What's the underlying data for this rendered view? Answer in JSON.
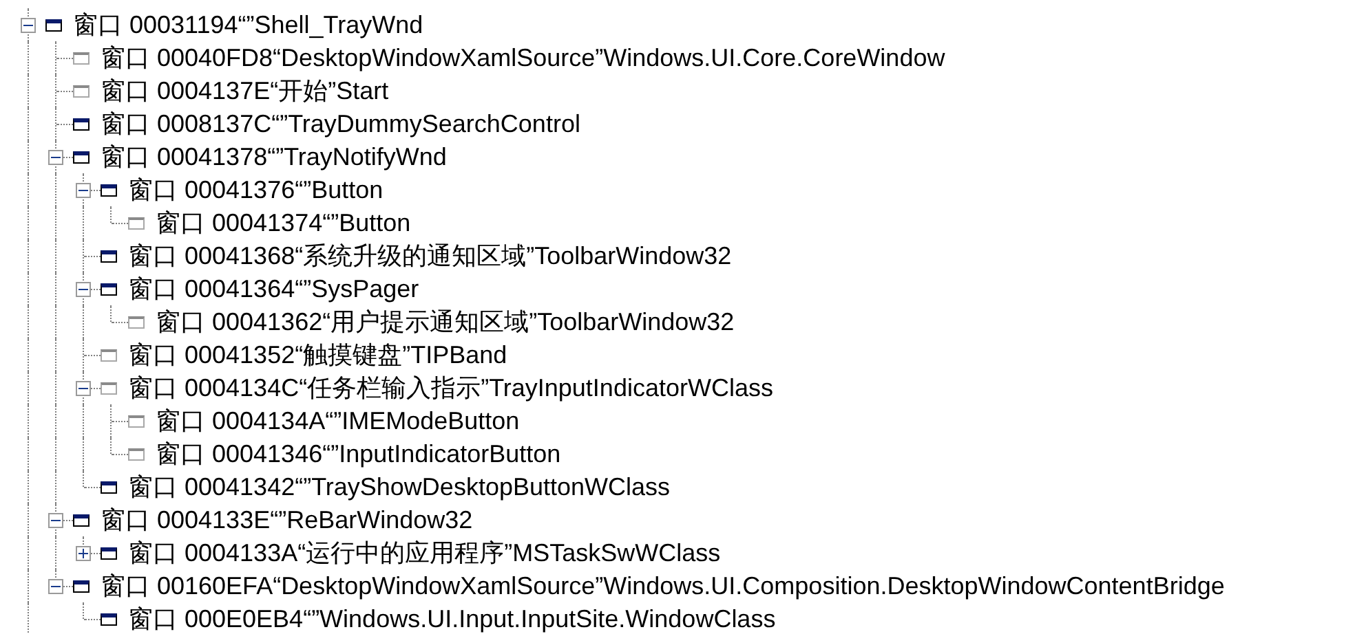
{
  "tree": [
    {
      "label": "窗口 00031194“”Shell_TrayWnd",
      "visible": true,
      "expanded": true,
      "children": [
        {
          "label": "窗口 00040FD8“DesktopWindowXamlSource”Windows.UI.Core.CoreWindow",
          "visible": false
        },
        {
          "label": "窗口 0004137E“开始”Start",
          "visible": false
        },
        {
          "label": "窗口 0008137C“”TrayDummySearchControl",
          "visible": true
        },
        {
          "label": "窗口 00041378“”TrayNotifyWnd",
          "visible": true,
          "expanded": true,
          "children": [
            {
              "label": "窗口 00041376“”Button",
              "visible": true,
              "expanded": true,
              "children": [
                {
                  "label": "窗口 00041374“”Button",
                  "visible": false
                }
              ]
            },
            {
              "label": "窗口 00041368“系统升级的通知区域”ToolbarWindow32",
              "visible": true
            },
            {
              "label": "窗口 00041364“”SysPager",
              "visible": true,
              "expanded": true,
              "children": [
                {
                  "label": "窗口 00041362“用户提示通知区域”ToolbarWindow32",
                  "visible": false
                }
              ]
            },
            {
              "label": "窗口 00041352“触摸键盘”TIPBand",
              "visible": false
            },
            {
              "label": "窗口 0004134C“任务栏输入指示”TrayInputIndicatorWClass",
              "visible": false,
              "expanded": true,
              "children": [
                {
                  "label": "窗口 0004134A“”IMEModeButton",
                  "visible": false
                },
                {
                  "label": "窗口 00041346“”InputIndicatorButton",
                  "visible": false
                }
              ]
            },
            {
              "label": "窗口 00041342“”TrayShowDesktopButtonWClass",
              "visible": true
            }
          ]
        },
        {
          "label": "窗口 0004133E“”ReBarWindow32",
          "visible": true,
          "expanded": true,
          "children": [
            {
              "label": "窗口 0004133A“运行中的应用程序”MSTaskSwWClass",
              "visible": true,
              "expanded": false
            }
          ]
        },
        {
          "label": "窗口 00160EFA“DesktopWindowXamlSource”Windows.UI.Composition.DesktopWindowContentBridge",
          "visible": true,
          "expanded": true,
          "children": [
            {
              "label": "窗口 000E0EB4“”Windows.UI.Input.InputSite.WindowClass",
              "visible": true
            }
          ]
        }
      ]
    }
  ]
}
